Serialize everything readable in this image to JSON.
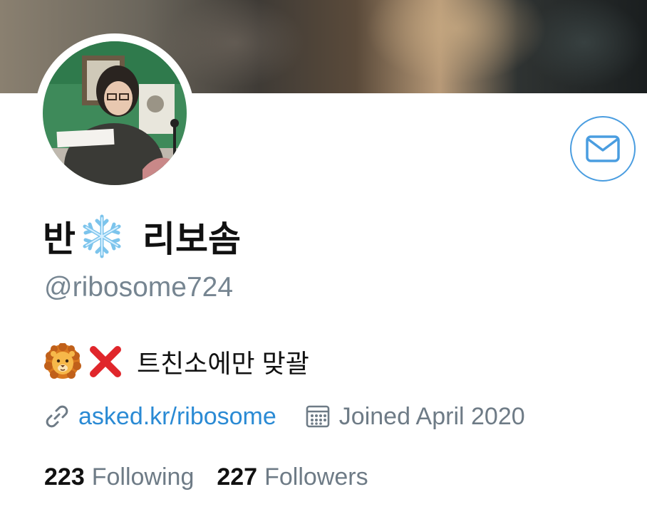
{
  "profile": {
    "display_name_prefix": "반",
    "display_name_suffix": "리보솜",
    "handle": "@ribosome724",
    "bio_text": "트친소에만 맞괄",
    "website": "asked.kr/ribosome",
    "joined": "Joined April 2020"
  },
  "stats": {
    "following_count": "223",
    "following_label": "Following",
    "followers_count": "227",
    "followers_label": "Followers"
  },
  "icons": {
    "display_name_emoji": "snowflake-icon",
    "bio_emoji_1": "lion-face-icon",
    "bio_emoji_2": "cross-mark-icon",
    "link": "link-icon",
    "joined": "calendar-icon",
    "message": "envelope-icon"
  },
  "colors": {
    "accent": "#4a9de0",
    "link": "#2a8ad4",
    "muted_text": "#6e7b86",
    "primary_text": "#111111"
  }
}
